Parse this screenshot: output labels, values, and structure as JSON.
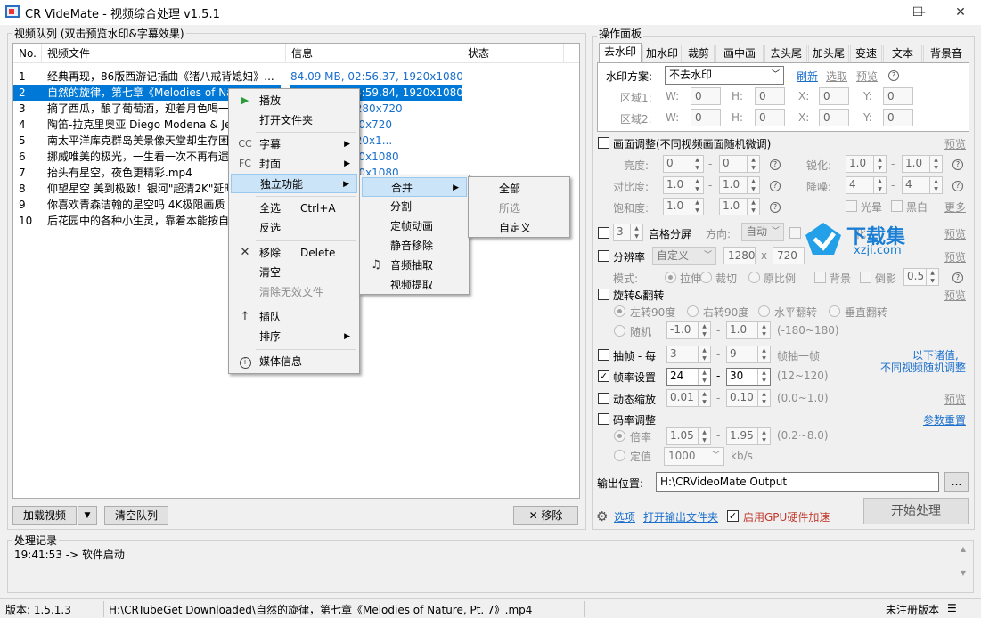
{
  "window": {
    "title": "CR VideMate - 视频综合处理 v1.5.1",
    "minimize": "—",
    "maximize": "☐",
    "close": "✕"
  },
  "queue": {
    "group_label": "视频队列 (双击预览水印&字幕效果)",
    "columns": [
      "No.",
      "视频文件",
      "信息",
      "状态"
    ],
    "rows": [
      {
        "no": "1",
        "file": "经典再现，86版西游记插曲《猪八戒背媳妇》...",
        "info": "84.09 MB, 02:56.37, 1920x1080"
      },
      {
        "no": "2",
        "file": "自然的旋律，第七章《Melodies of Nature, Pt...",
        "info": "76.36 MB, 05:59.84, 1920x1080"
      },
      {
        "no": "3",
        "file": "摘了西瓜，酿了葡萄酒，迎着月色喝一",
        "info": "...0:33.93, 1280x720"
      },
      {
        "no": "4",
        "file": "陶笛-拉克里奥亚 Diego Modena & Jea",
        "info": "...15.63, 1280x720"
      },
      {
        "no": "5",
        "file": "南太平洋库克群岛美景像天堂却生存困",
        "info": "...:59.47, 1920x1..."
      },
      {
        "no": "6",
        "file": "挪威唯美的极光，一生看一次不再有遗",
        "info": "...49.23, 1920x1080"
      },
      {
        "no": "7",
        "file": "抬头有星空，夜色更精彩.mp4",
        "info": "...10.47, 1920x1080"
      },
      {
        "no": "8",
        "file": "仰望星空 美到极致！银河\"超清2K\"延时",
        "info": ""
      },
      {
        "no": "9",
        "file": "你喜欢青森洁翰的星空吗 4K极限画质",
        "info": ""
      },
      {
        "no": "10",
        "file": "后花园中的各种小生灵，靠着本能按自",
        "info": ""
      }
    ],
    "selected_row": 1,
    "load_button": "加载视频",
    "load_arrow": "▼",
    "clear_button": "清空队列",
    "remove_button": "✕ 移除"
  },
  "context_menu": {
    "items": {
      "play": {
        "icon": "▶",
        "label": "播放"
      },
      "open_folder": {
        "label": "打开文件夹"
      },
      "subtitle": {
        "icon": "CC",
        "label": "字幕"
      },
      "cover": {
        "icon": "FC",
        "label": "封面"
      },
      "standalone": {
        "label": "独立功能"
      },
      "select_all": {
        "label": "全选",
        "shortcut": "Ctrl+A"
      },
      "invert": {
        "label": "反选"
      },
      "remove": {
        "icon": "✕",
        "label": "移除",
        "shortcut": "Delete"
      },
      "clear": {
        "label": "清空"
      },
      "clear_invalid": {
        "label": "清除无效文件"
      },
      "insert": {
        "icon": "↑",
        "label": "插队"
      },
      "sort": {
        "label": "排序"
      },
      "media_info": {
        "icon": "i",
        "label": "媒体信息"
      }
    },
    "arrow": "▶"
  },
  "submenu_standalone": {
    "merge": "合并",
    "split": "分割",
    "freeze": "定帧动画",
    "mute": "静音移除",
    "audio_extract": "音频抽取",
    "video_extract": "视频提取",
    "audio_icon": "♫"
  },
  "submenu_merge": {
    "all": "全部",
    "selected": "所选",
    "custom": "自定义"
  },
  "panel": {
    "group_label": "操作面板",
    "tabs": [
      "去水印",
      "加水印",
      "裁剪",
      "画中画",
      "去头尾",
      "加头尾",
      "变速",
      "文本",
      "背景音"
    ],
    "watermark": {
      "scheme_label": "水印方案:",
      "scheme_value": "不去水印",
      "refresh": "刷新",
      "select": "选取",
      "preview": "预览",
      "area1": "区域1:",
      "area2": "区域2:",
      "w": "W:",
      "h": "H:",
      "x": "X:",
      "y": "Y:",
      "zero": "0"
    },
    "adjust": {
      "title": "画面调整(不同视频画面随机微调)",
      "preview": "预览",
      "brightness": "亮度:",
      "contrast": "对比度:",
      "saturation": "饱和度:",
      "sharpen": "锐化:",
      "denoise": "降噪:",
      "b1": "0",
      "b2": "0",
      "c1": "1.0",
      "c2": "1.0",
      "s1": "1.0",
      "s2": "1.0",
      "sh1": "1.0",
      "sh2": "1.0",
      "d1": "4",
      "d2": "4",
      "halo": "光晕",
      "bw": "黑白",
      "more": "更多"
    },
    "grid": {
      "value": "3",
      "label": "宫格分屏",
      "direction": "方向:",
      "dir_value": "自动",
      "ratio_tail": "化",
      "preview": "预览"
    },
    "resolution": {
      "label": "分辨率",
      "value": "自定义",
      "w": "1280",
      "x": "x",
      "h": "720",
      "preview": "预览",
      "mode": "模式:",
      "stretch": "拉伸",
      "crop": "裁切",
      "original": "原比例",
      "bg": "背景",
      "reflect": "倒影",
      "reflect_value": "0.5"
    },
    "rotate": {
      "label": "旋转&翻转",
      "preview": "预览",
      "left90": "左转90度",
      "right90": "右转90度",
      "hflip": "水平翻转",
      "vflip": "垂直翻转",
      "random": "随机",
      "r1": "-1.0",
      "r2": "1.0",
      "range": "(-180~180)"
    },
    "frame_drop": {
      "label": "抽帧 - 每",
      "v1": "3",
      "v2": "9",
      "tail": "帧抽一帧"
    },
    "note": {
      "line1": "以下诸值,",
      "line2": "不同视频随机调整"
    },
    "fps": {
      "label": "帧率设置",
      "v1": "24",
      "v2": "30",
      "range": "(12~120)",
      "check": "✓"
    },
    "zoom": {
      "label": "动态缩放",
      "v1": "0.01",
      "v2": "0.10",
      "range": "(0.0~1.0)",
      "preview": "预览"
    },
    "bitrate": {
      "label": "码率调整",
      "reset": "参数重置",
      "multiplier": "倍率",
      "m1": "1.05",
      "m2": "1.95",
      "range": "(0.2~8.0)",
      "fixed": "定值",
      "fixed_value": "1000",
      "unit": "kb/s"
    },
    "output": {
      "label": "输出位置:",
      "path": "H:\\CRVideoMate Output",
      "browse": "..."
    },
    "bottom": {
      "options": "选项",
      "open_output": "打开输出文件夹",
      "gpu": "启用GPU硬件加速",
      "gpu_check": "✓",
      "start": "开始处理"
    },
    "dash": "-"
  },
  "log": {
    "label": "处理记录",
    "entry": "19:41:53 -> 软件启动"
  },
  "statusbar": {
    "version": "版本:  1.5.1.3",
    "file": "H:\\CRTubeGet Downloaded\\自然的旋律，第七章《Melodies of Nature, Pt. 7》.mp4",
    "registration": "未注册版本",
    "menu": "☰"
  },
  "watermark_logo": {
    "text": "下载集",
    "url": "xzji.com"
  },
  "colors": {
    "accent": "#0078d7",
    "link": "#1a6fcc",
    "gpu_label": "#c0392b"
  }
}
